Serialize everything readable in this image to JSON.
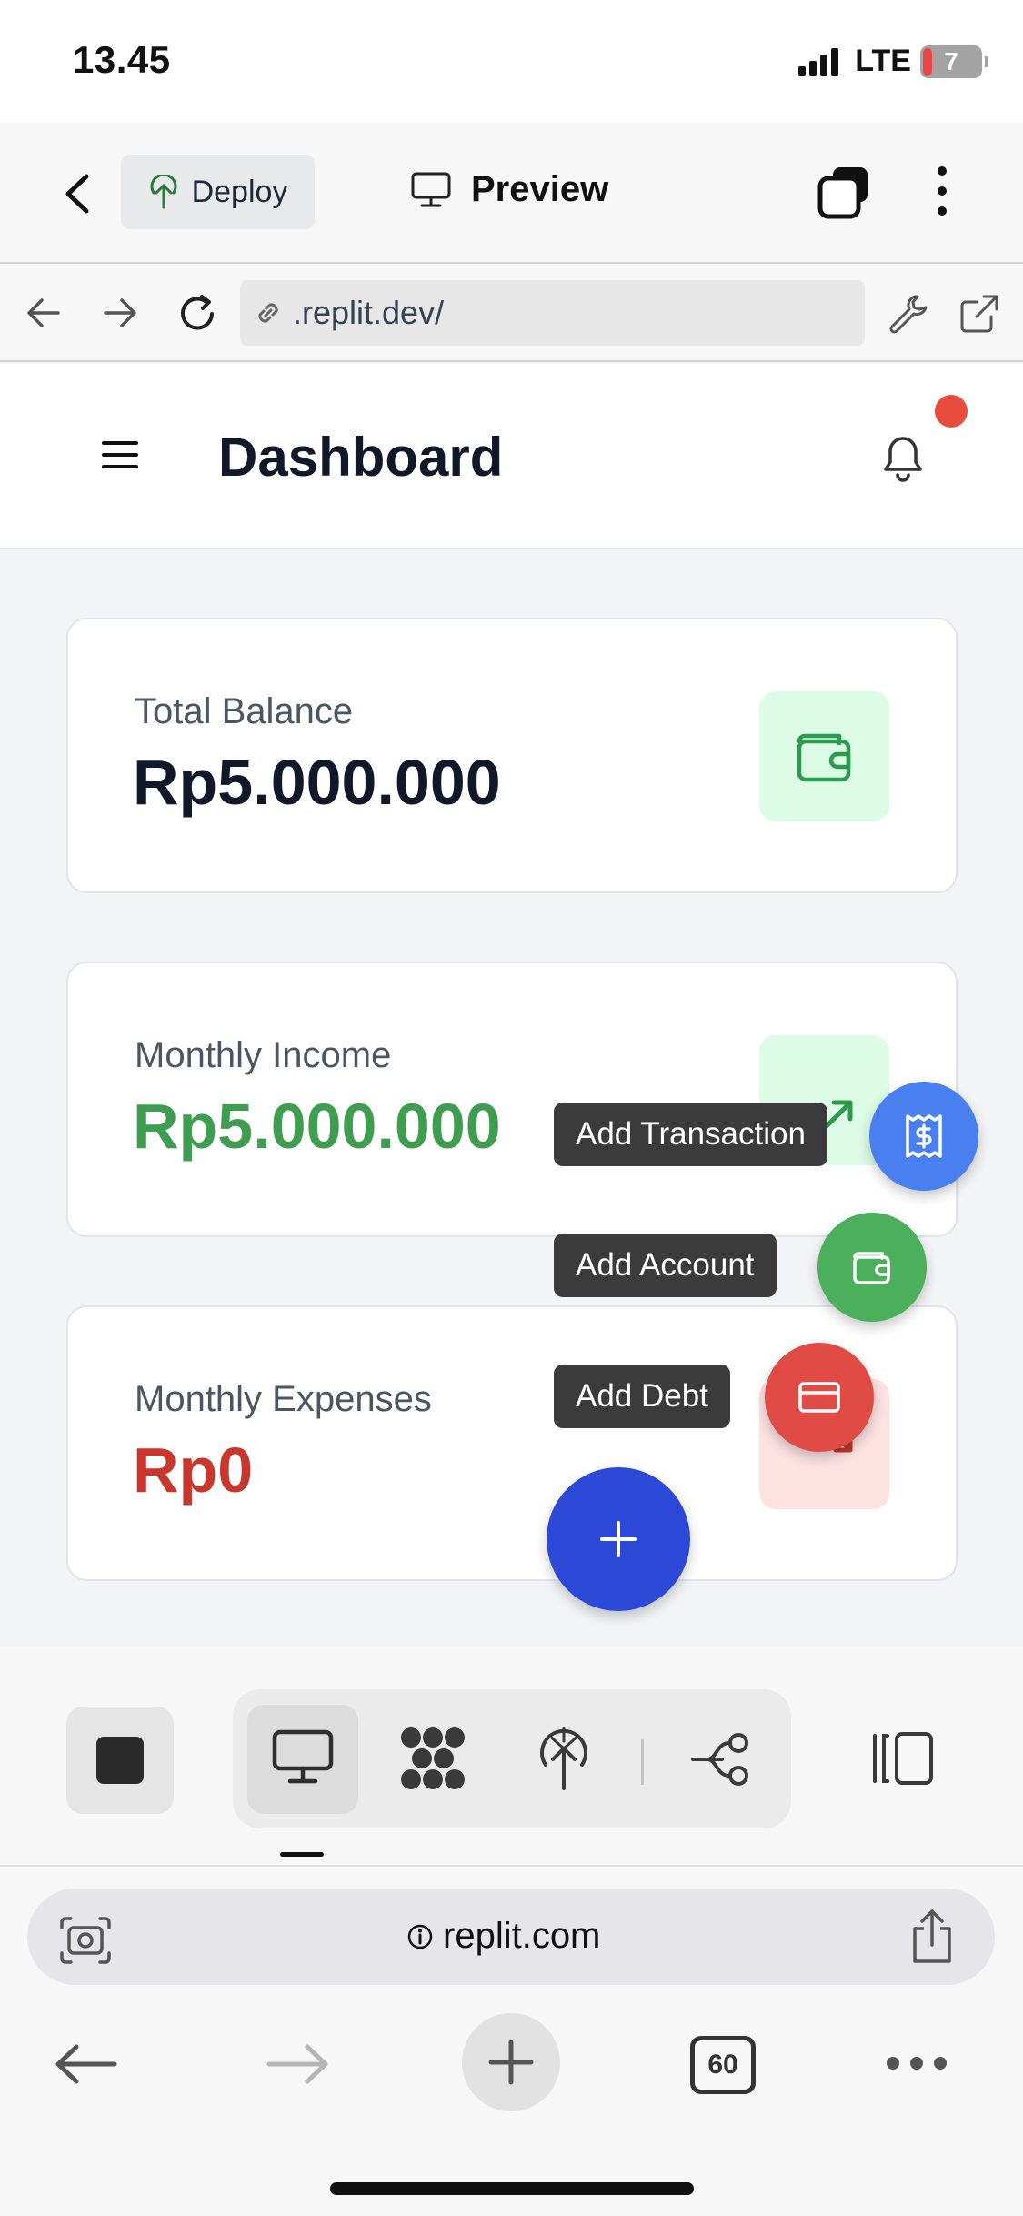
{
  "status_bar": {
    "time": "13.45",
    "network": "LTE",
    "battery": "7"
  },
  "replit_header": {
    "deploy_label": "Deploy",
    "preview_label": "Preview"
  },
  "url_bar": {
    "url": ".replit.dev/"
  },
  "app": {
    "title": "Dashboard",
    "cards": [
      {
        "label": "Total Balance",
        "value": "Rp5.000.000",
        "icon": "wallet-icon",
        "value_color": "#111827",
        "icon_bg": "#dcfce7"
      },
      {
        "label": "Monthly Income",
        "value": "Rp5.000.000",
        "icon": "trending-up-icon",
        "value_color": "#3e9d50",
        "icon_bg": "#dcfce7"
      },
      {
        "label": "Monthly Expenses",
        "value": "Rp0",
        "icon": "trending-down-icon",
        "value_color": "#c8372d",
        "icon_bg": "#fde2e2"
      }
    ]
  },
  "speed_dial": {
    "actions": [
      {
        "label": "Add Transaction",
        "icon": "receipt-dollar-icon",
        "color": "#4a7ff0"
      },
      {
        "label": "Add Account",
        "icon": "wallet-icon",
        "color": "#4caf5c"
      },
      {
        "label": "Add Debt",
        "icon": "credit-card-icon",
        "color": "#e04b46"
      }
    ],
    "main_color": "#2c48d6"
  },
  "safari": {
    "domain": "replit.com",
    "tab_count": "60"
  }
}
